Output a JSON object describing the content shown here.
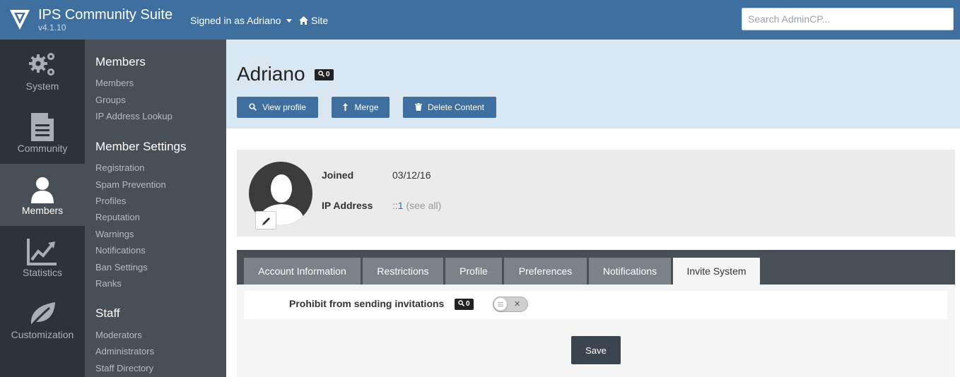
{
  "header": {
    "brand_title": "IPS Community Suite",
    "brand_version": "v4.1.10",
    "signed_in": "Signed in as Adriano",
    "site_link": "Site",
    "search_placeholder": "Search AdminCP..."
  },
  "appnav": [
    {
      "label": "System",
      "icon": "gears-icon"
    },
    {
      "label": "Community",
      "icon": "document-icon"
    },
    {
      "label": "Members",
      "icon": "user-icon",
      "active": true
    },
    {
      "label": "Statistics",
      "icon": "chart-icon"
    },
    {
      "label": "Customization",
      "icon": "leaf-icon"
    }
  ],
  "subnav": {
    "sections": [
      {
        "title": "Members",
        "links": [
          "Members",
          "Groups",
          "IP Address Lookup"
        ]
      },
      {
        "title": "Member Settings",
        "links": [
          "Registration",
          "Spam Prevention",
          "Profiles",
          "Reputation",
          "Warnings",
          "Notifications",
          "Ban Settings",
          "Ranks"
        ]
      },
      {
        "title": "Staff",
        "links": [
          "Moderators",
          "Administrators",
          "Staff Directory"
        ]
      }
    ]
  },
  "page": {
    "title": "Adriano",
    "search_badge": "0",
    "buttons": {
      "view_profile": "View profile",
      "merge": "Merge",
      "delete_content": "Delete Content"
    }
  },
  "profile": {
    "joined_label": "Joined",
    "joined_value": "03/12/16",
    "ip_label": "IP Address",
    "ip_prefix": "::",
    "ip_value": "1",
    "see_all": "(see all)"
  },
  "tabs": [
    {
      "label": "Account Information"
    },
    {
      "label": "Restrictions"
    },
    {
      "label": "Profile"
    },
    {
      "label": "Preferences"
    },
    {
      "label": "Notifications"
    },
    {
      "label": "Invite System",
      "active": true
    }
  ],
  "form": {
    "field_label": "Prohibit from sending invitations",
    "field_badge": "0",
    "toggle_on": false,
    "save_label": "Save"
  },
  "colors": {
    "brand": "#3e6f9e",
    "sidebar_dark": "#2e3338",
    "sidebar": "#474f57",
    "header_bg": "#d9e7f3"
  }
}
